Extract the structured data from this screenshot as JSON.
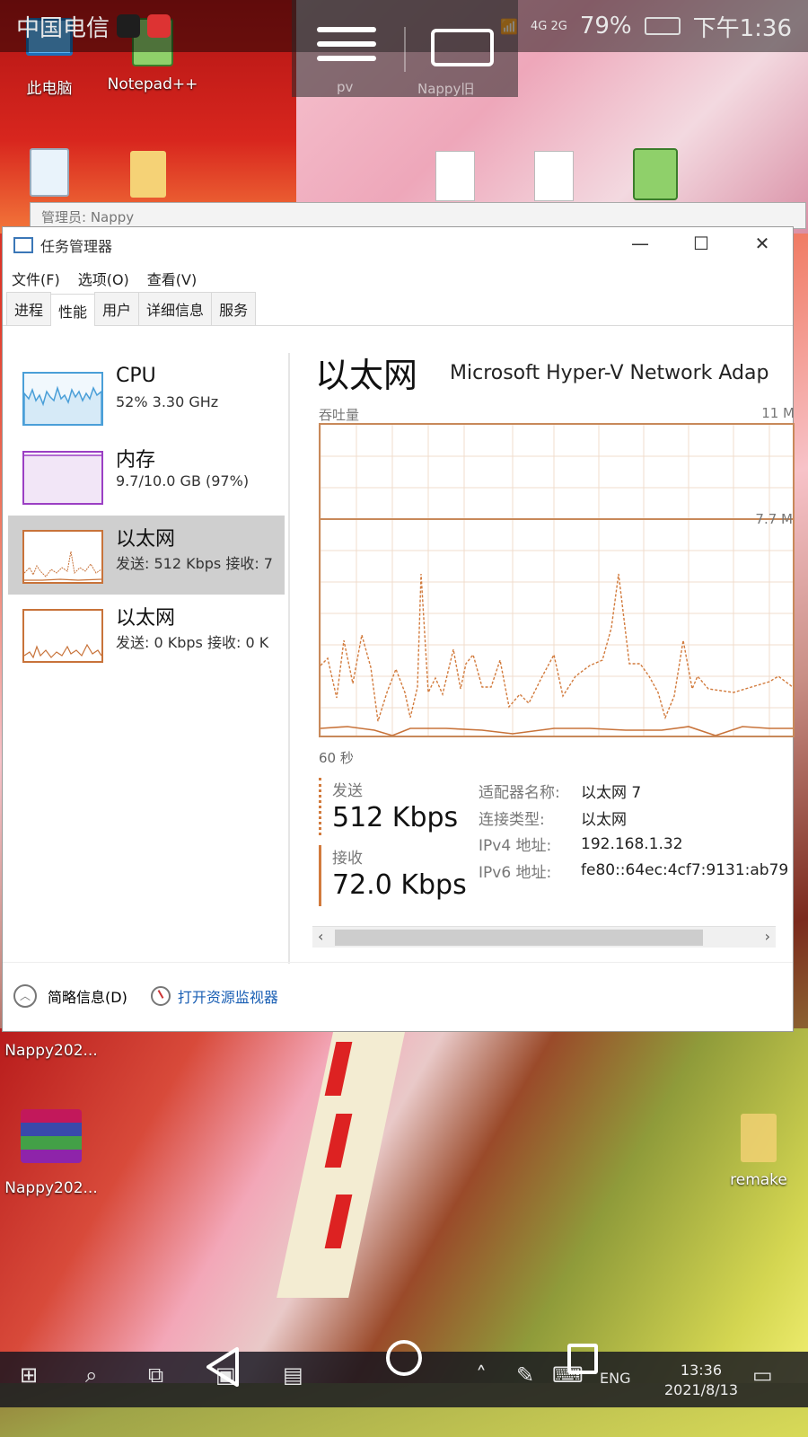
{
  "statusbar": {
    "carrier": "中国电信",
    "battery": "79%",
    "time": "下午1:36",
    "network": "4G 2G"
  },
  "keyboard_toolbar": {
    "left_label": "pv",
    "right_label": "Nappy旧"
  },
  "desktop": {
    "icons": [
      {
        "label": "此电脑"
      },
      {
        "label": "Notepad++"
      },
      {
        "label": "Nappy202..."
      },
      {
        "label": "Nappy202..."
      },
      {
        "label": "remake"
      }
    ]
  },
  "bg_window": {
    "title": "管理员: Nappy"
  },
  "task_manager": {
    "title": "任务管理器",
    "window_controls": {
      "minimize": "—",
      "maximize": "☐",
      "close": "✕"
    },
    "menu": [
      "文件(F)",
      "选项(O)",
      "查看(V)"
    ],
    "tabs": [
      "进程",
      "性能",
      "用户",
      "详细信息",
      "服务"
    ],
    "active_tab": "性能",
    "resources": [
      {
        "name": "CPU",
        "sub": "52%  3.30 GHz",
        "color": "#4a9fd8"
      },
      {
        "name": "内存",
        "sub": "9.7/10.0 GB (97%)",
        "color": "#9b3fc4"
      },
      {
        "name": "以太网",
        "sub": "发送: 512 Kbps  接收: 7",
        "color": "#c8733a"
      },
      {
        "name": "以太网",
        "sub": "发送: 0 Kbps  接收: 0 K",
        "color": "#c8733a"
      }
    ],
    "detail": {
      "title": "以太网",
      "adapter_header": "Microsoft Hyper-V Network Adap",
      "graph_label": "吞吐量",
      "graph_max": "11 M",
      "graph_mark": "7.7 M",
      "time_span": "60 秒",
      "send_label": "发送",
      "send_value": "512 Kbps",
      "recv_label": "接收",
      "recv_value": "72.0 Kbps",
      "properties": [
        {
          "key": "适配器名称:",
          "value": "以太网 7"
        },
        {
          "key": "连接类型:",
          "value": "以太网"
        },
        {
          "key": "IPv4 地址:",
          "value": "192.168.1.32"
        },
        {
          "key": "IPv6 地址:",
          "value": "fe80::64ec:4cf7:9131:ab79"
        }
      ]
    },
    "footer": {
      "brief": "简略信息(D)",
      "monitor_link": "打开资源监视器"
    }
  },
  "taskbar": {
    "lang": "ENG",
    "clock_time": "13:36",
    "clock_date": "2021/8/13"
  }
}
